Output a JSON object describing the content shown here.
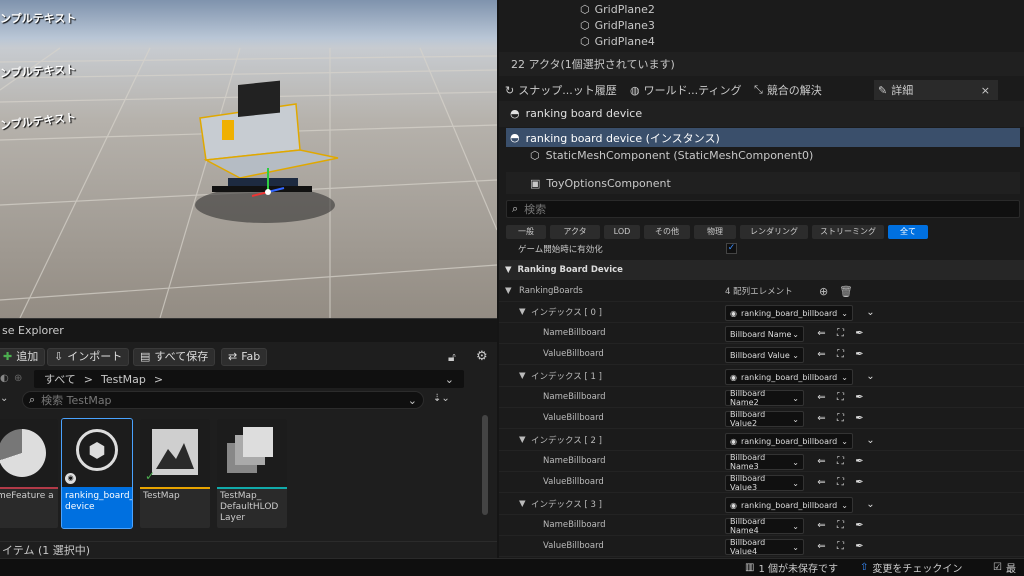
{
  "viewport": {
    "sample_texts": [
      "ンプルテキスト",
      "ンプルテキスト",
      "ンプルテキスト"
    ]
  },
  "outliner": {
    "items": [
      "GridPlane2",
      "GridPlane3",
      "GridPlane4"
    ],
    "actor_count": "22 アクタ(1個選択されています)"
  },
  "tabs": {
    "snapshot": "スナップ...ット履歴",
    "world": "ワールド...ティング",
    "conflict": "競合の解決",
    "details": "詳細",
    "close": "×"
  },
  "details": {
    "actor_name": "ranking board device",
    "components": {
      "root": "ranking board device (インスタンス)",
      "mesh": "StaticMeshComponent (StaticMeshComponent0)",
      "toy": "ToyOptionsComponent"
    },
    "search_placeholder": "検索",
    "categories": [
      "一般",
      "アクタ",
      "LOD",
      "その他",
      "物理",
      "レンダリング",
      "ストリーミング",
      "全て"
    ],
    "enable_label": "ゲーム開始時に有効化",
    "section": "Ranking Board Device",
    "ranking_boards_label": "RankingBoards",
    "array_count": "4 配列エレメント",
    "entries": [
      {
        "index": "インデックス [ 0 ]",
        "board": "ranking_board_billboard",
        "name_label": "NameBillboard",
        "name_value": "Billboard Name",
        "value_label": "ValueBillboard",
        "value_value": "Billboard Value"
      },
      {
        "index": "インデックス [ 1 ]",
        "board": "ranking_board_billboard",
        "name_label": "NameBillboard",
        "name_value": "Billboard Name2",
        "value_label": "ValueBillboard",
        "value_value": "Billboard Value2"
      },
      {
        "index": "インデックス [ 2 ]",
        "board": "ranking_board_billboard",
        "name_label": "NameBillboard",
        "name_value": "Billboard Name3",
        "value_label": "ValueBillboard",
        "value_value": "Billboard Value3"
      },
      {
        "index": "インデックス [ 3 ]",
        "board": "ranking_board_billboard",
        "name_label": "NameBillboard",
        "name_value": "Billboard Name4",
        "value_label": "ValueBillboard",
        "value_value": "Billboard Value4"
      }
    ]
  },
  "content_browser": {
    "title": "se Explorer",
    "add": "追加",
    "import": "インポート",
    "save_all": "すべて保存",
    "fab": "Fab",
    "path_root": "すべて",
    "path_sep": ">",
    "path_folder": "TestMap",
    "search_placeholder": "検索 TestMap",
    "assets": [
      "meFeature a",
      "ranking_board_ device",
      "TestMap",
      "TestMap_ DefaultHLOD Layer"
    ],
    "status": "イテム (1 選択中)"
  },
  "status_bar": {
    "unsaved": "1 個が未保存です",
    "checkin": "変更をチェックイン",
    "last": "最"
  },
  "colors": {
    "accent": "#0070e0",
    "selected_row": "#3a4f6b"
  }
}
